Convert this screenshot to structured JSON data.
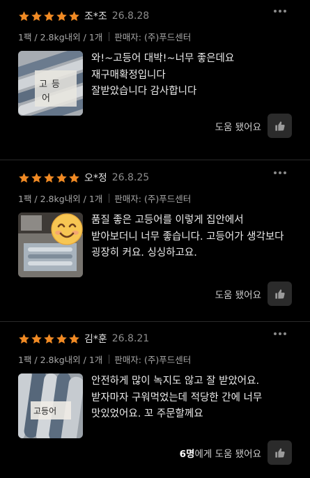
{
  "reviews": [
    {
      "rating": 5,
      "author": "조*조",
      "date": "26.8.28",
      "option": "1팩 / 2.8kg내외 / 1개",
      "seller": "판매자: (주)푸드센터",
      "lines": [
        "와!~고등어  대박!~너무  좋은데요",
        "재구매확정입니다",
        "잘받았습니다 감사합니다"
      ],
      "helpful_label": "도움 됐어요",
      "helpful_count": ""
    },
    {
      "rating": 5,
      "author": "오*정",
      "date": "26.8.25",
      "option": "1팩 / 2.8kg내외 / 1개",
      "seller": "판매자: (주)푸드센터",
      "lines": [
        "품질 좋은 고등어를 이렇게 집안에서",
        "받아보더니 너무 좋습니다. 고등어가 생각보다",
        "굉장히 커요. 싱싱하고요."
      ],
      "helpful_label": "도움 됐어요",
      "helpful_count": ""
    },
    {
      "rating": 5,
      "author": "김*훈",
      "date": "26.8.21",
      "option": "1팩 / 2.8kg내외 / 1개",
      "seller": "판매자: (주)푸드센터",
      "lines": [
        "안전하게 많이 녹지도 않고 잘 받았어요.",
        "받자마자 구워먹었는데 적당한 간에 너무",
        "맛있었어요. 꼬 주문할께요"
      ],
      "helpful_label": "에게 도움 됐어요",
      "helpful_count": "6명"
    }
  ],
  "icons": {
    "star": "star-icon",
    "more": "more-dots-icon",
    "thumbs_up": "thumbs-up-icon",
    "emoji": "smiling-face-emoji"
  },
  "colors": {
    "star": "#f08a24",
    "background": "#000000"
  }
}
